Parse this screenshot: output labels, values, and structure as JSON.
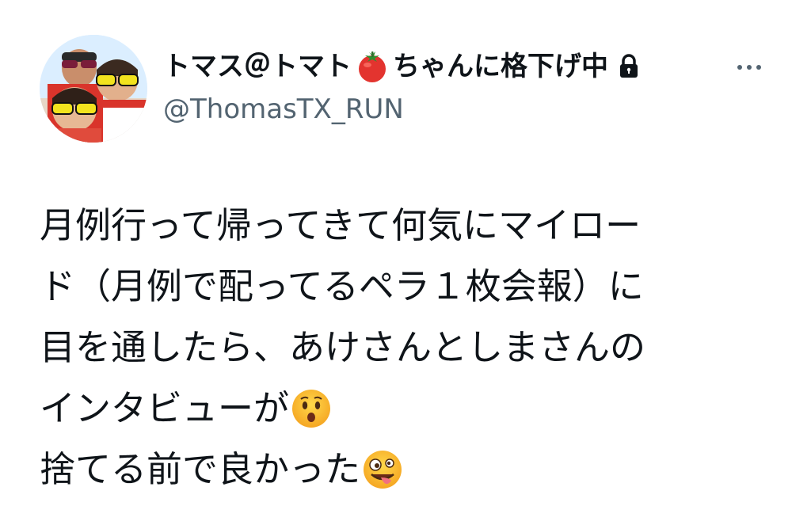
{
  "author": {
    "name_prefix": "トマス＠トマト",
    "name_suffix": "ちゃんに格下げ中",
    "handle": "@ThomasTX_RUN",
    "name_emoji": "tomato-icon",
    "protected_icon": "lock-icon"
  },
  "more_icon": "more-horizontal-icon",
  "tweet": {
    "lines": [
      "月例行って帰ってきて何気にマイロー",
      "ド（月例で配ってるペラ１枚会報）に",
      "目を通したら、あけさんとしまさんの",
      "インタビューが",
      "捨てる前で良かった"
    ],
    "emojis": [
      "hushed-face-icon",
      "zany-face-icon"
    ]
  },
  "colors": {
    "text": "#0f1419",
    "secondary": "#536471",
    "background": "#ffffff"
  }
}
